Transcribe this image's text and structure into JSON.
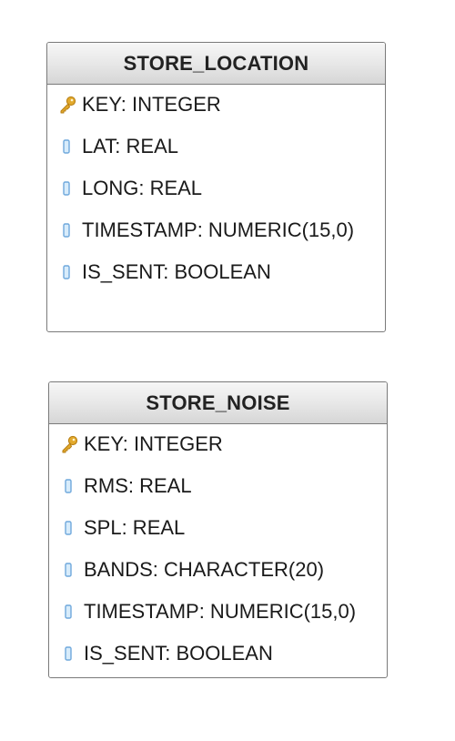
{
  "entities": [
    {
      "name": "STORE_LOCATION",
      "attributes": [
        {
          "label": "KEY: INTEGER",
          "icon": "key-icon",
          "primary_key": true
        },
        {
          "label": "LAT: REAL",
          "icon": "column-icon",
          "primary_key": false
        },
        {
          "label": "LONG: REAL",
          "icon": "column-icon",
          "primary_key": false
        },
        {
          "label": "TIMESTAMP: NUMERIC(15,0)",
          "icon": "column-icon",
          "primary_key": false
        },
        {
          "label": "IS_SENT: BOOLEAN",
          "icon": "column-icon",
          "primary_key": false
        }
      ]
    },
    {
      "name": "STORE_NOISE",
      "attributes": [
        {
          "label": "KEY: INTEGER",
          "icon": "key-icon",
          "primary_key": true
        },
        {
          "label": "RMS: REAL",
          "icon": "column-icon",
          "primary_key": false
        },
        {
          "label": "SPL: REAL",
          "icon": "column-icon",
          "primary_key": false
        },
        {
          "label": "BANDS: CHARACTER(20)",
          "icon": "column-icon",
          "primary_key": false
        },
        {
          "label": "TIMESTAMP: NUMERIC(15,0)",
          "icon": "column-icon",
          "primary_key": false
        },
        {
          "label": "IS_SENT: BOOLEAN",
          "icon": "column-icon",
          "primary_key": false
        }
      ]
    }
  ],
  "colors": {
    "border": "#7a7a7a",
    "header_top": "#f7f7f7",
    "header_bottom": "#d6d6d6",
    "key_icon": "#e2a92c",
    "column_icon": "#6fa8dc"
  }
}
